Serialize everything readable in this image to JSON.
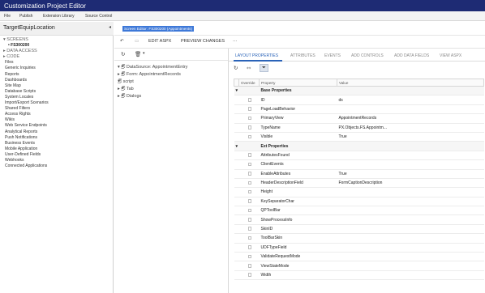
{
  "window": {
    "title": "Customization Project Editor"
  },
  "menu": {
    "items": [
      "File",
      "Publish",
      "Extension Library",
      "Source Control"
    ]
  },
  "project": {
    "name": "TargetEquipLocation"
  },
  "left_tree": {
    "screens_label": "SCREENS",
    "screen_item": "FS300200",
    "data_access_label": "DATA ACCESS",
    "code_label": "CODE",
    "items": [
      "Files",
      "Generic Inquiries",
      "Reports",
      "Dashboards",
      "Site Map",
      "Database Scripts",
      "System Locales",
      "Import/Export Scenarios",
      "Shared Filters",
      "Access Rights",
      "Wikis",
      "Web Service Endpoints",
      "Analytical Reports",
      "Push Notifications",
      "Business Events",
      "Mobile Application",
      "User-Defined Fields",
      "Webhooks",
      "Connected Applications"
    ]
  },
  "breadcrumb": "Screen Editor: FS300200 (Appointments)",
  "toolbar": {
    "edit_aspx": "EDIT ASPX",
    "preview_changes": "PREVIEW CHANGES",
    "more": "···"
  },
  "tree": {
    "datasource": "DataSource: AppointmentEntry",
    "form": "Form: AppointmentRecords",
    "script": "script",
    "tab": "Tab",
    "dialogs": "Dialogs"
  },
  "tabs": [
    "LAYOUT PROPERTIES",
    "ATTRIBUTES",
    "EVENTS",
    "ADD CONTROLS",
    "ADD DATA FIELDS",
    "VIEW ASPX"
  ],
  "grid": {
    "headers": {
      "override": "Override",
      "property": "Property",
      "value": "Value"
    },
    "rows": [
      {
        "group": true,
        "property": "Base Properties",
        "value": ""
      },
      {
        "group": false,
        "property": "ID",
        "value": "ds"
      },
      {
        "group": false,
        "property": "PageLoadBehavior",
        "value": ""
      },
      {
        "group": false,
        "property": "PrimaryView",
        "value": "AppointmentRecords"
      },
      {
        "group": false,
        "property": "TypeName",
        "value": "PX.Objects.FS.Appointm..."
      },
      {
        "group": false,
        "property": "Visible",
        "value": "True"
      },
      {
        "group": true,
        "property": "Ext Properties",
        "value": ""
      },
      {
        "group": false,
        "property": "AttributesFound",
        "value": ""
      },
      {
        "group": false,
        "property": "ClientEvents",
        "value": ""
      },
      {
        "group": false,
        "property": "EnableAttributes",
        "value": "True"
      },
      {
        "group": false,
        "property": "HeaderDescriptionField",
        "value": "FormCaptionDescription"
      },
      {
        "group": false,
        "property": "Height",
        "value": ""
      },
      {
        "group": false,
        "property": "KeySeparatorChar",
        "value": ""
      },
      {
        "group": false,
        "property": "QPToolBar",
        "value": ""
      },
      {
        "group": false,
        "property": "ShowProcessInfo",
        "value": ""
      },
      {
        "group": false,
        "property": "SkinID",
        "value": ""
      },
      {
        "group": false,
        "property": "ToolBarSkin",
        "value": ""
      },
      {
        "group": false,
        "property": "UDFTypeField",
        "value": ""
      },
      {
        "group": false,
        "property": "ValidateRequestMode",
        "value": ""
      },
      {
        "group": false,
        "property": "ViewStateMode",
        "value": ""
      },
      {
        "group": false,
        "property": "Width",
        "value": ""
      }
    ]
  }
}
